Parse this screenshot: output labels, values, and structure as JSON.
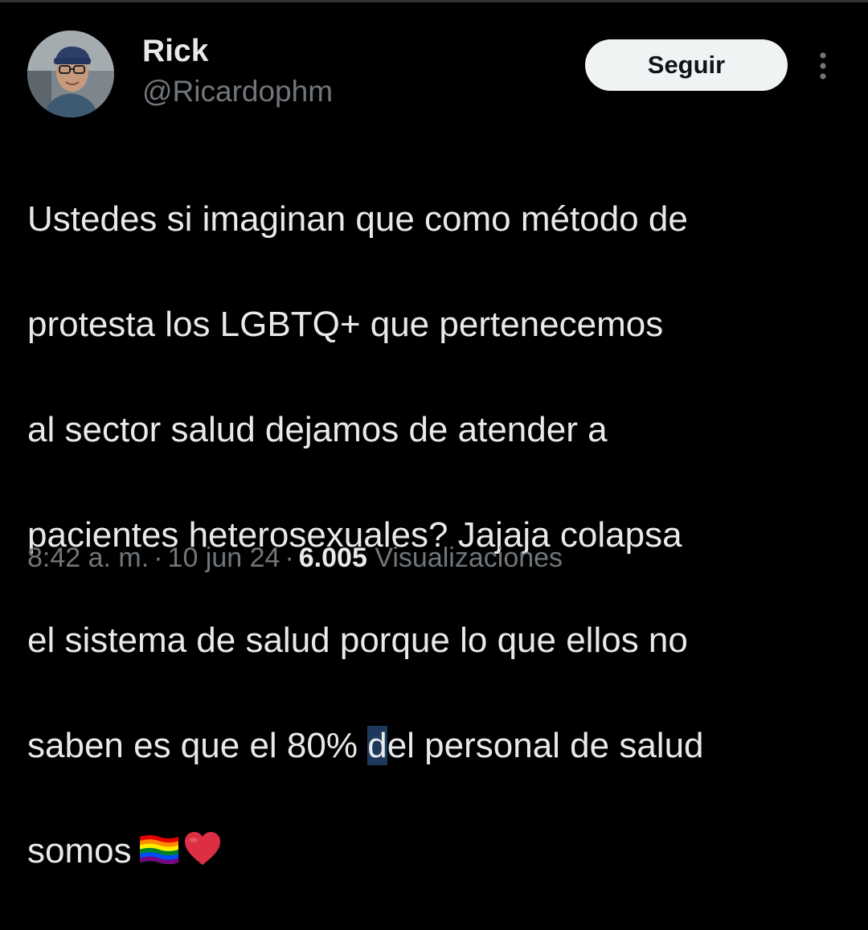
{
  "tweet": {
    "author": {
      "name": "Rick",
      "handle": "@Ricardophm",
      "avatar_icon": "profile-photo"
    },
    "follow_label": "Seguir",
    "more_icon": "more-vertical-icon",
    "text_lines": [
      "Ustedes si imaginan que como método de",
      "protesta los LGBTQ+ que pertenecemos",
      "al sector salud dejamos de atender a",
      "pacientes heterosexuales? Jajaja colapsa",
      "el sistema de salud porque lo que ellos no",
      "saben es que el 80% ",
      "d",
      "el personal de salud",
      "somos"
    ],
    "emojis": [
      "rainbow-flag-emoji",
      "red-heart-emoji"
    ],
    "timestamp": {
      "time": "8:42 a. m.",
      "separator": "·",
      "date": "10 jun 24"
    },
    "views": {
      "count": "6.005",
      "label": "Visualizaciones"
    }
  },
  "colors": {
    "background": "#000000",
    "text_primary": "#e7e9ea",
    "text_secondary": "#71767b",
    "button_bg": "#eff3f4",
    "button_text": "#0f1419",
    "selection": "#1d3a5c"
  }
}
